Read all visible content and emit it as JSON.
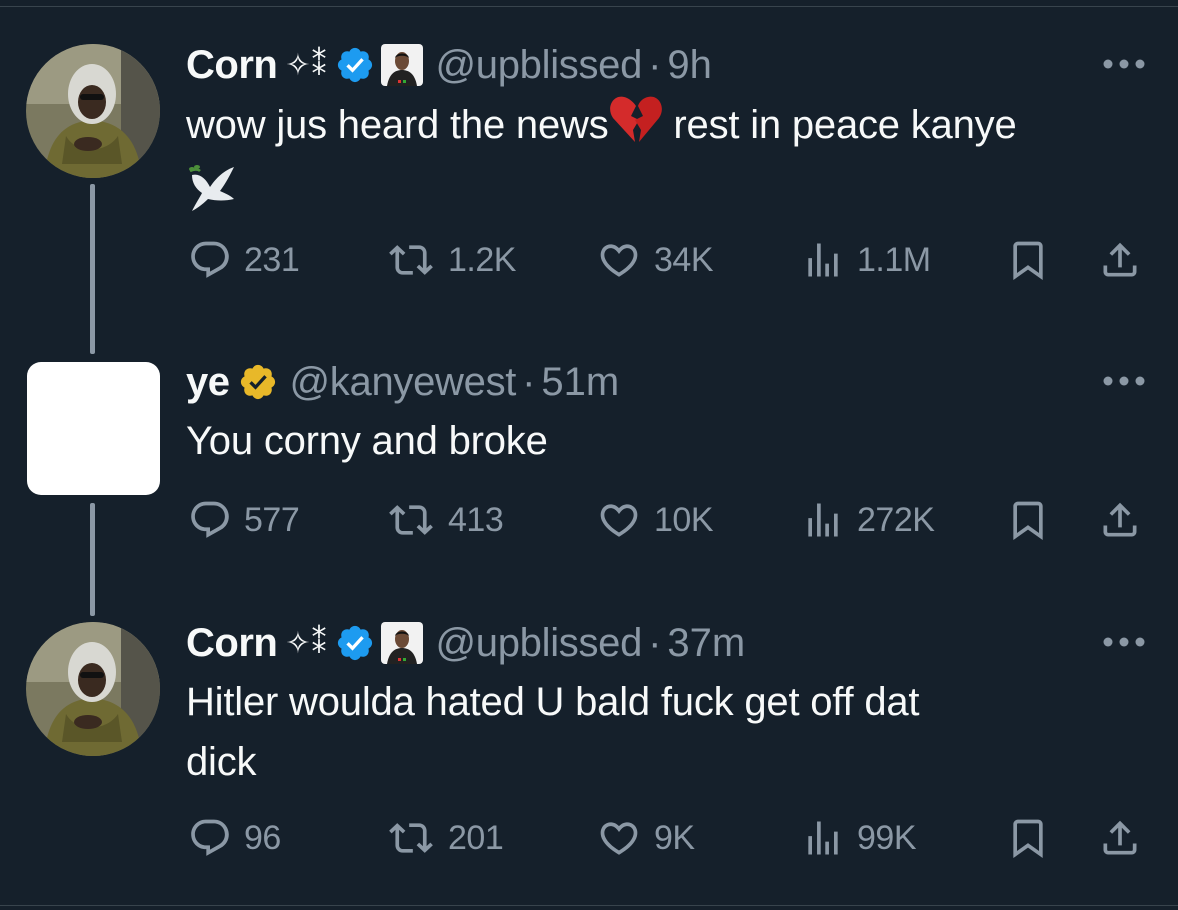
{
  "thread": [
    {
      "avatar_icon": "user-photo-avatar",
      "display_name": "Corn",
      "name_suffix": "✧⁑",
      "verified_color": "#1d9bf0",
      "has_affiliate_badge": true,
      "handle": "@upblissed",
      "separator": "·",
      "time": "9h",
      "text_before_emoji": "wow jus heard the news",
      "emoji": "broken-heart",
      "text_after_emoji": " rest in peace kanye",
      "trailing_emoji": "dove",
      "stats": {
        "replies": "231",
        "reposts": "1.2K",
        "likes": "34K",
        "views": "1.1M"
      }
    },
    {
      "avatar_icon": "blank-white-avatar",
      "display_name": "ye",
      "verified_color": "#e8b829",
      "handle": "@kanyewest",
      "separator": "·",
      "time": "51m",
      "text": "You corny and broke",
      "stats": {
        "replies": "577",
        "reposts": "413",
        "likes": "10K",
        "views": "272K"
      }
    },
    {
      "avatar_icon": "user-photo-avatar",
      "display_name": "Corn",
      "name_suffix": "✧⁑",
      "verified_color": "#1d9bf0",
      "has_affiliate_badge": true,
      "handle": "@upblissed",
      "separator": "·",
      "time": "37m",
      "text_line1": "Hitler woulda hated U bald fuck get off dat",
      "text_line2": "dick",
      "stats": {
        "replies": "96",
        "reposts": "201",
        "likes": "9K",
        "views": "99K"
      }
    }
  ],
  "colors": {
    "background": "#15202b",
    "primary_text": "#f7f9f9",
    "secondary_text": "#8b98a5",
    "thread_line": "#8b98a5",
    "divider": "#38444d"
  }
}
